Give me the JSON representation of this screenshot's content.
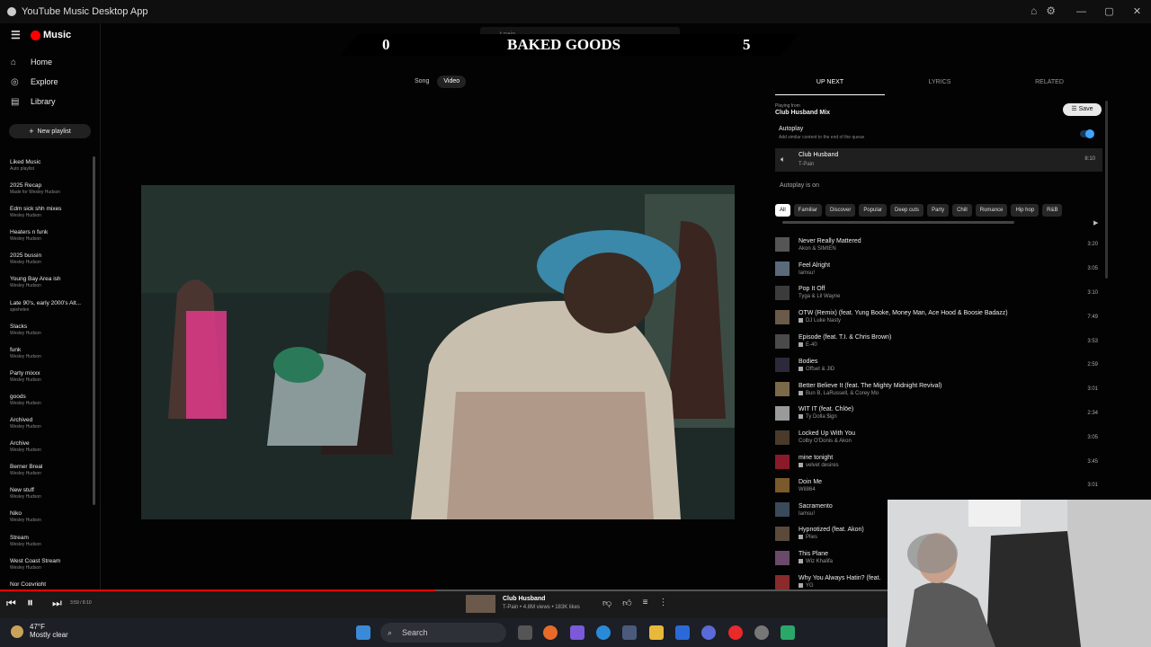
{
  "window": {
    "title": "YouTube Music Desktop App"
  },
  "search": {
    "value": "t pain"
  },
  "sidebar": {
    "logo": "Music",
    "nav": [
      {
        "label": "Home",
        "icon": "home-icon"
      },
      {
        "label": "Explore",
        "icon": "compass-icon"
      },
      {
        "label": "Library",
        "icon": "library-icon"
      }
    ],
    "new_playlist": "New playlist",
    "playlists": [
      {
        "name": "Liked Music",
        "sub": "Auto playlist"
      },
      {
        "name": "2025 Recap",
        "sub": "Made for Wesley Hudson"
      },
      {
        "name": "Edm sick shh mixes",
        "sub": "Wesley Hudson"
      },
      {
        "name": "Heaters n funk",
        "sub": "Wesley Hudson"
      },
      {
        "name": "2025 bussin",
        "sub": "Wesley Hudson"
      },
      {
        "name": "Young Bay Area ish",
        "sub": "Wesley Hudson"
      },
      {
        "name": "Late 90's, early 2000's Alt...",
        "sub": "spiehelen"
      },
      {
        "name": "Slacks",
        "sub": "Wesley Hudson"
      },
      {
        "name": "funk",
        "sub": "Wesley Hudson"
      },
      {
        "name": "Party mixxx",
        "sub": "Wesley Hudson"
      },
      {
        "name": "goods",
        "sub": "Wesley Hudson"
      },
      {
        "name": "Archived",
        "sub": "Wesley Hudson"
      },
      {
        "name": "Archive",
        "sub": "Wesley Hudson"
      },
      {
        "name": "Berner Breal",
        "sub": "Wesley Hudson"
      },
      {
        "name": "New stuff",
        "sub": "Wesley Hudson"
      },
      {
        "name": "Niko",
        "sub": "Wesley Hudson"
      },
      {
        "name": "Stream",
        "sub": "Wesley Hudson"
      },
      {
        "name": "West Coast Stream",
        "sub": "Wesley Hudson"
      },
      {
        "name": "Nor Copyright",
        "sub": ""
      }
    ]
  },
  "scoreboard": {
    "left_score": "0",
    "title": "BAKED GOODS",
    "right_score": "5"
  },
  "mode_toggle": {
    "song": "Song",
    "video": "Video"
  },
  "right_panel": {
    "tabs": [
      "UP NEXT",
      "LYRICS",
      "RELATED"
    ],
    "playing_from_label": "Playing from",
    "playing_from": "Club Husband Mix",
    "save": "Save",
    "autoplay_title": "Autoplay",
    "autoplay_desc": "Add similar content to the end of the queue",
    "current": {
      "title": "Club Husband",
      "artist": "T-Pain",
      "duration": "8:10"
    },
    "autoplay_on": "Autoplay is on",
    "chips": [
      "All",
      "Familiar",
      "Discover",
      "Popular",
      "Deep cuts",
      "Party",
      "Chill",
      "Romance",
      "Hip hop",
      "R&B"
    ],
    "queue": [
      {
        "title": "Never Really Mattered",
        "artist": "Akon & SIMIEN",
        "duration": "3:20",
        "thumb": "#555",
        "badge": false
      },
      {
        "title": "Feel Alright",
        "artist": "Iamsu!",
        "duration": "3:05",
        "thumb": "#5a6a7a",
        "badge": false
      },
      {
        "title": "Pop It Off",
        "artist": "Tyga & Lil Wayne",
        "duration": "3:10",
        "thumb": "#3b3b3b",
        "badge": false
      },
      {
        "title": "OTW (Remix) (feat. Yung Booke, Money Man, Ace Hood & Boosie Badazz)",
        "artist": "DJ Luke Nasty",
        "duration": "7:49",
        "thumb": "#6a5a4a",
        "badge": true
      },
      {
        "title": "Episode (feat. T.I. & Chris Brown)",
        "artist": "E-40",
        "duration": "3:53",
        "thumb": "#4a4a4a",
        "badge": true
      },
      {
        "title": "Bodies",
        "artist": "Offset & JID",
        "duration": "2:59",
        "thumb": "#2a2a3a",
        "badge": true
      },
      {
        "title": "Better Believe It (feat. The Mighty Midnight Revival)",
        "artist": "Bun B, LaRussell, & Corey Mo",
        "duration": "3:01",
        "thumb": "#7a6a4a",
        "badge": true
      },
      {
        "title": "WIT IT (feat. Chlöe)",
        "artist": "Ty Dolla $ign",
        "duration": "2:34",
        "thumb": "#9a9a9a",
        "badge": true
      },
      {
        "title": "Locked Up With You",
        "artist": "Colby O'Donis & Akon",
        "duration": "3:05",
        "thumb": "#4a3a2a",
        "badge": false
      },
      {
        "title": "mine tonight",
        "artist": "velvet desires",
        "duration": "3:45",
        "thumb": "#8a1a2a",
        "badge": true
      },
      {
        "title": "Doin Me",
        "artist": "WiI864",
        "duration": "3:01",
        "thumb": "#7a5a2a",
        "badge": false
      },
      {
        "title": "Sacramento",
        "artist": "Iamsu!",
        "duration": "",
        "thumb": "#3a4a5a",
        "badge": false
      },
      {
        "title": "Hypnotized (feat. Akon)",
        "artist": "Plies",
        "duration": "",
        "thumb": "#5a4a3a",
        "badge": true
      },
      {
        "title": "This Plane",
        "artist": "Wiz Khalifa",
        "duration": "",
        "thumb": "#6a4a6a",
        "badge": true
      },
      {
        "title": "Why You Always Hatin? (feat.",
        "artist": "YG",
        "duration": "",
        "thumb": "#8a2a2a",
        "badge": true
      }
    ]
  },
  "player": {
    "time": "3:59 / 8:10",
    "progress": 0.49,
    "title": "Club Husband",
    "subtitle": "T-Pain • 4.8M views • 183K likes"
  },
  "taskbar": {
    "temp": "47°F",
    "condition": "Mostly clear",
    "search": "Search"
  }
}
